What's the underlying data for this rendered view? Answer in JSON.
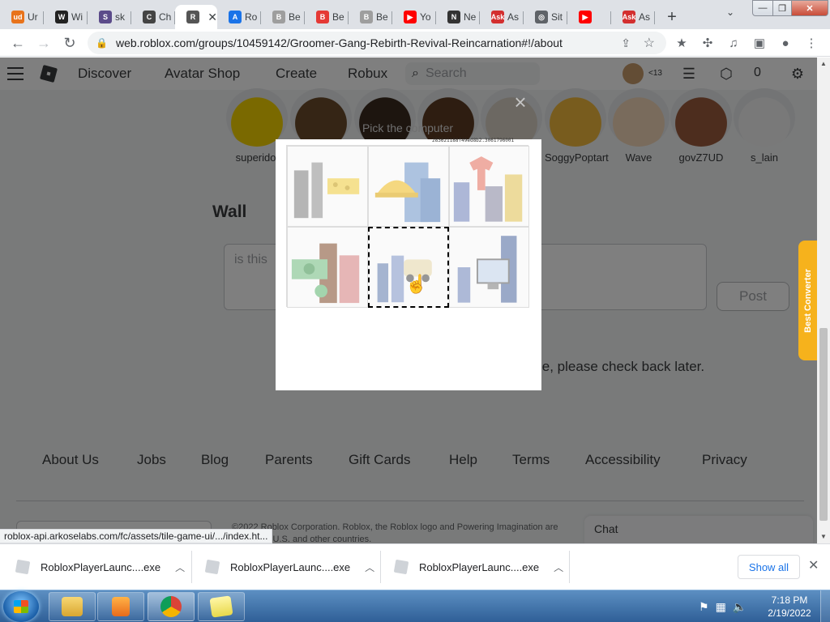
{
  "tabs": [
    {
      "label": "Ur",
      "favicon": "ud-icon",
      "color": "#e8731b",
      "glyph": "ud"
    },
    {
      "label": "Wi",
      "favicon": "wikipedia-icon",
      "color": "#222222",
      "glyph": "W"
    },
    {
      "label": "sk",
      "favicon": "skin-icon",
      "color": "#5b4b8a",
      "glyph": "S"
    },
    {
      "label": "Ch",
      "favicon": "chrome-web-icon",
      "color": "#444444",
      "glyph": "C"
    },
    {
      "label": "",
      "favicon": "roblox-icon",
      "color": "#555555",
      "glyph": "R",
      "active": true
    },
    {
      "label": "Ro",
      "favicon": "arkose-icon",
      "color": "#1a73e8",
      "glyph": "A"
    },
    {
      "label": "Be",
      "favicon": "document-icon",
      "color": "#9e9e9e",
      "glyph": "B"
    },
    {
      "label": "Be",
      "favicon": "rainbow-icon",
      "color": "#e53935",
      "glyph": "B"
    },
    {
      "label": "Be",
      "favicon": "document-icon",
      "color": "#9e9e9e",
      "glyph": "B"
    },
    {
      "label": "Yo",
      "favicon": "youtube-icon",
      "color": "#ff0000",
      "glyph": "▶"
    },
    {
      "label": "Ne",
      "favicon": "github-icon",
      "color": "#333333",
      "glyph": "N"
    },
    {
      "label": "As",
      "favicon": "ask-icon",
      "color": "#d32f2f",
      "glyph": "Ask"
    },
    {
      "label": "Sit",
      "favicon": "globe-icon",
      "color": "#5f6368",
      "glyph": "◎"
    },
    {
      "label": "",
      "favicon": "youtube-icon",
      "color": "#ff0000",
      "glyph": "▶"
    },
    {
      "label": "As",
      "favicon": "ask-icon",
      "color": "#d32f2f",
      "glyph": "Ask"
    }
  ],
  "url": "web.roblox.com/groups/10459142/Groomer-Gang-Rebirth-Revival-Reincarnation#!/about",
  "roblox": {
    "nav": [
      "Discover",
      "Avatar Shop",
      "Create",
      "Robux"
    ],
    "search_placeholder": "Search",
    "age_label": "<13",
    "robux_count": "0"
  },
  "members": [
    {
      "name": "superidol",
      "skin": "#f5d200"
    },
    {
      "name": "",
      "skin": "#6b4a2b"
    },
    {
      "name": "",
      "skin": "#3a2a1f"
    },
    {
      "name": "",
      "skin": "#5c3b22"
    },
    {
      "name": "",
      "skin": "#d8d0c4"
    },
    {
      "name": "SoggyPoptart",
      "skin": "#f0b83c"
    },
    {
      "name": "Wave",
      "skin": "#f2d6b8"
    },
    {
      "name": "govZ7UD",
      "skin": "#9a5b3c"
    },
    {
      "name": "s_lain",
      "skin": "#f2f2f2"
    }
  ],
  "wall": {
    "title": "Wall",
    "input_placeholder": "is this",
    "post_label": "Post",
    "notice": "le, please check back later."
  },
  "footer": {
    "links": [
      "About Us",
      "Jobs",
      "Blog",
      "Parents",
      "Gift Cards",
      "Help",
      "Terms",
      "Accessibility",
      "Privacy"
    ],
    "copyright_line1": "©2022 Roblox Corporation. Roblox, the Roblox logo and Powering Imagination are",
    "copyright_line2": "s in the U.S. and other countries.",
    "chat_label": "Chat"
  },
  "side_tab_label": "Best Converter",
  "captcha": {
    "title": "Pick the computer",
    "id": "283621188f49ed8b2.3061796001",
    "tiles": [
      {
        "content": "cheese-building",
        "selected": false
      },
      {
        "content": "hardhat-building",
        "selected": false
      },
      {
        "content": "shirt-building",
        "selected": false
      },
      {
        "content": "money-building",
        "selected": false
      },
      {
        "content": "car-building",
        "selected": true
      },
      {
        "content": "computer-building",
        "selected": false
      }
    ]
  },
  "status_url": "roblox-api.arkoselabs.com/fc/assets/tile-game-ui/.../index.ht...",
  "downloads": [
    {
      "filename": "RobloxPlayerLaunc....exe"
    },
    {
      "filename": "RobloxPlayerLaunc....exe"
    },
    {
      "filename": "RobloxPlayerLaunc....exe"
    }
  ],
  "show_all_label": "Show all",
  "clock": {
    "time": "7:18 PM",
    "date": "2/19/2022"
  }
}
